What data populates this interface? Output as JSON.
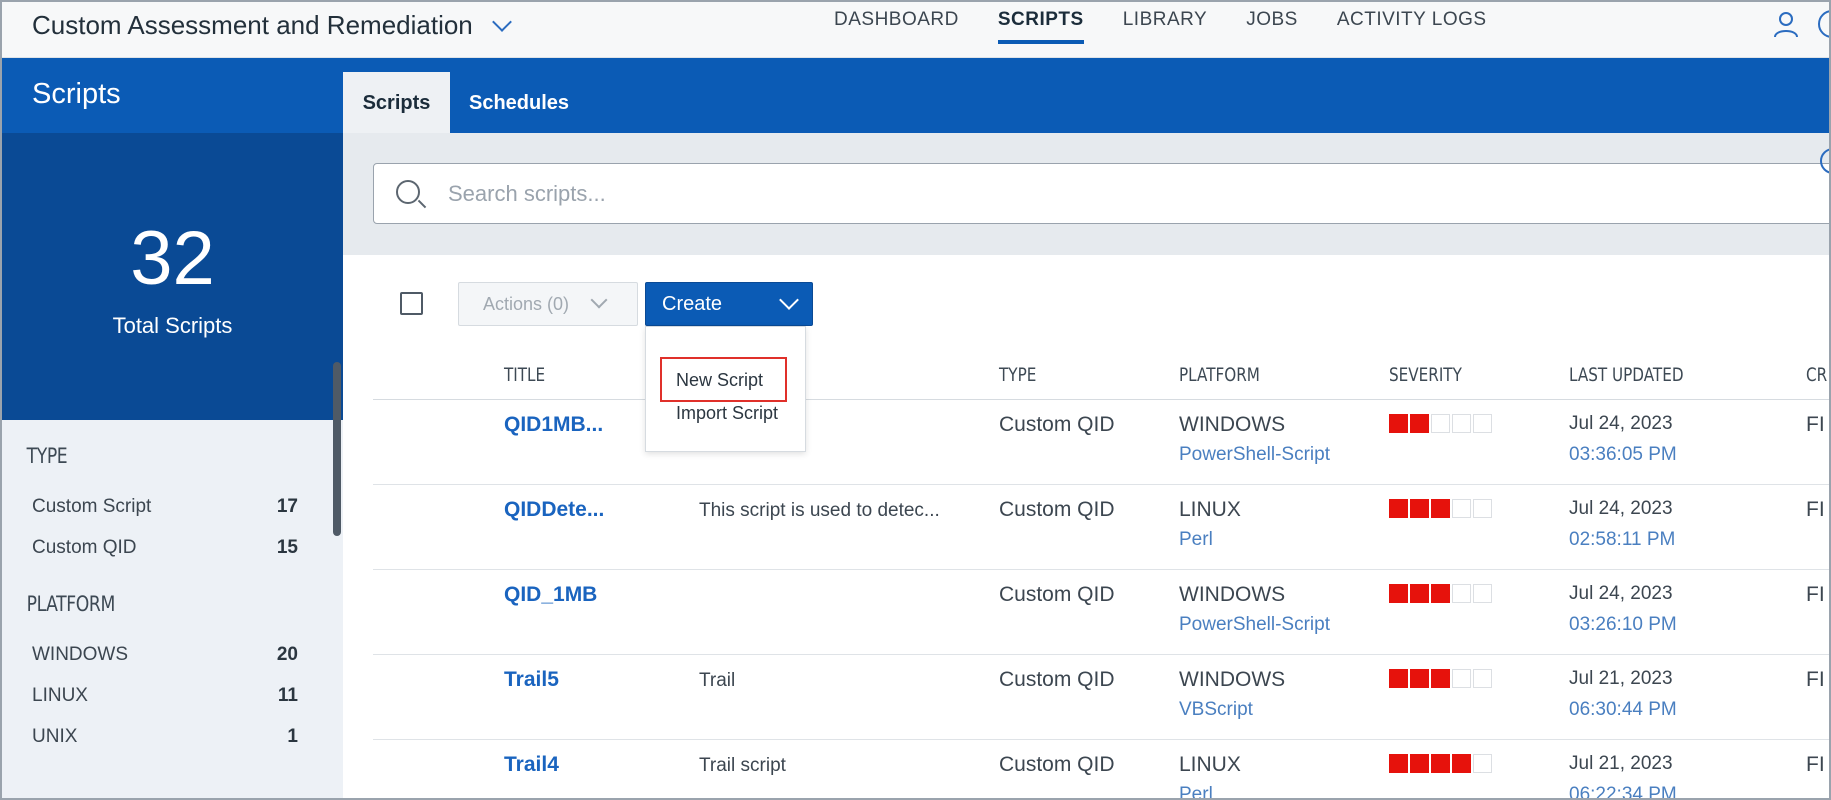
{
  "app": {
    "title": "Custom Assessment and Remediation"
  },
  "nav": [
    {
      "label": "DASHBOARD",
      "active": false
    },
    {
      "label": "SCRIPTS",
      "active": true
    },
    {
      "label": "LIBRARY",
      "active": false
    },
    {
      "label": "JOBS",
      "active": false
    },
    {
      "label": "ACTIVITY LOGS",
      "active": false
    }
  ],
  "sidebar": {
    "heading": "Scripts",
    "total_count": "32",
    "total_label": "Total Scripts",
    "facets": [
      {
        "title": "TYPE",
        "items": [
          {
            "label": "Custom Script",
            "count": "17"
          },
          {
            "label": "Custom QID",
            "count": "15"
          }
        ]
      },
      {
        "title": "PLATFORM",
        "items": [
          {
            "label": "WINDOWS",
            "count": "20"
          },
          {
            "label": "LINUX",
            "count": "11"
          },
          {
            "label": "UNIX",
            "count": "1"
          }
        ]
      }
    ]
  },
  "tabs": [
    {
      "label": "Scripts",
      "active": true
    },
    {
      "label": "Schedules",
      "active": false
    }
  ],
  "search": {
    "placeholder": "Search scripts..."
  },
  "toolbar": {
    "actions_label": "Actions (0)",
    "create_label": "Create"
  },
  "create_menu": [
    {
      "label": "New Script",
      "highlighted": true
    },
    {
      "label": "Import Script",
      "highlighted": false
    }
  ],
  "table": {
    "columns": [
      "TITLE",
      "TYPE",
      "PLATFORM",
      "SEVERITY",
      "LAST UPDATED",
      "CR"
    ],
    "rows": [
      {
        "title": "QID1MB...",
        "description": "",
        "type": "Custom QID",
        "platform": "WINDOWS",
        "language": "PowerShell-Script",
        "severity": 2,
        "date": "Jul 24, 2023",
        "time": "03:36:05 PM",
        "extra": "FI"
      },
      {
        "title": "QIDDete...",
        "description": "This script is used to detec...",
        "type": "Custom QID",
        "platform": "LINUX",
        "language": "Perl",
        "severity": 3,
        "date": "Jul 24, 2023",
        "time": "02:58:11 PM",
        "extra": "FI"
      },
      {
        "title": "QID_1MB",
        "description": "",
        "type": "Custom QID",
        "platform": "WINDOWS",
        "language": "PowerShell-Script",
        "severity": 3,
        "date": "Jul 24, 2023",
        "time": "03:26:10 PM",
        "extra": "FI"
      },
      {
        "title": "Trail5",
        "description": "Trail",
        "type": "Custom QID",
        "platform": "WINDOWS",
        "language": "VBScript",
        "severity": 3,
        "date": "Jul 21, 2023",
        "time": "06:30:44 PM",
        "extra": "FI"
      },
      {
        "title": "Trail4",
        "description": "Trail script",
        "type": "Custom QID",
        "platform": "LINUX",
        "language": "Perl",
        "severity": 4,
        "date": "Jul 21, 2023",
        "time": "06:22:34 PM",
        "extra": "FI"
      }
    ],
    "severity_max": 5
  },
  "colors": {
    "brand_blue": "#0b5bb5",
    "dark_blue": "#0a4a95",
    "severity_red": "#e6120c",
    "link_blue": "#1a64bf",
    "highlight_red": "#e0302a"
  }
}
